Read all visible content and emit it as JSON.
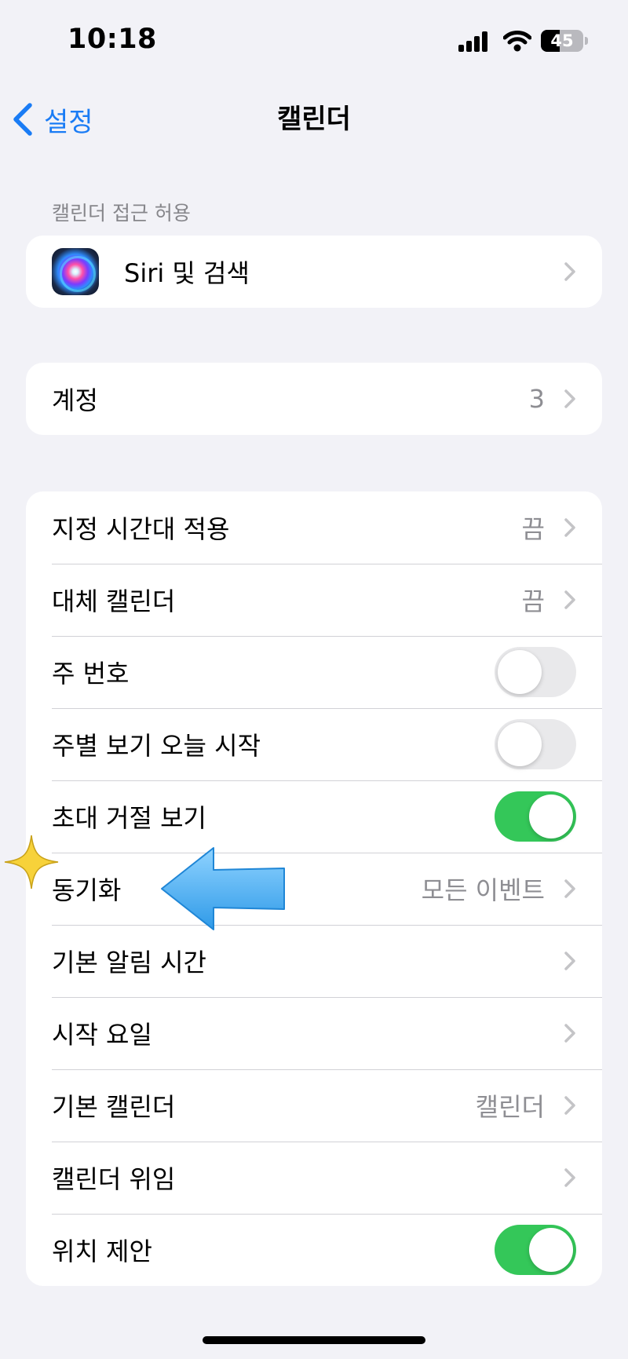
{
  "status_bar": {
    "time": "10:18",
    "battery_level": "45",
    "battery_percent": 45
  },
  "nav": {
    "back_label": "설정",
    "title": "캘린더"
  },
  "access_section": {
    "header": "캘린더 접근 허용",
    "siri_label": "Siri 및 검색"
  },
  "accounts": {
    "label": "계정",
    "value": "3"
  },
  "settings": {
    "time_zone_override": {
      "label": "지정 시간대 적용",
      "value": "끔"
    },
    "alternate_calendars": {
      "label": "대체 캘린더",
      "value": "끔"
    },
    "week_numbers": {
      "label": "주 번호",
      "on": false
    },
    "week_view_today": {
      "label": "주별 보기 오늘 시작",
      "on": false
    },
    "show_declined": {
      "label": "초대 거절 보기",
      "on": true
    },
    "sync": {
      "label": "동기화",
      "value": "모든 이벤트"
    },
    "default_alert_times": {
      "label": "기본 알림 시간"
    },
    "start_week_on": {
      "label": "시작 요일"
    },
    "default_calendar": {
      "label": "기본 캘린더",
      "value": "캘린더"
    },
    "delegate_calendars": {
      "label": "캘린더 위임"
    },
    "location_suggestions": {
      "label": "위치 제안",
      "on": true
    }
  },
  "colors": {
    "accent": "#1a7cf5",
    "toggle_on": "#34c759",
    "toggle_off": "#e9e9eb",
    "background": "#f2f2f7",
    "annotation_arrow": "#4fb3f5",
    "annotation_sparkle": "#f7d23a"
  },
  "icons": {
    "signal": "cellular-signal-icon",
    "wifi": "wifi-icon",
    "battery": "battery-icon",
    "back": "chevron-left-icon",
    "siri": "siri-icon",
    "disclosure": "chevron-right-icon",
    "sparkle": "sparkle-icon",
    "arrow": "arrow-left-icon"
  }
}
